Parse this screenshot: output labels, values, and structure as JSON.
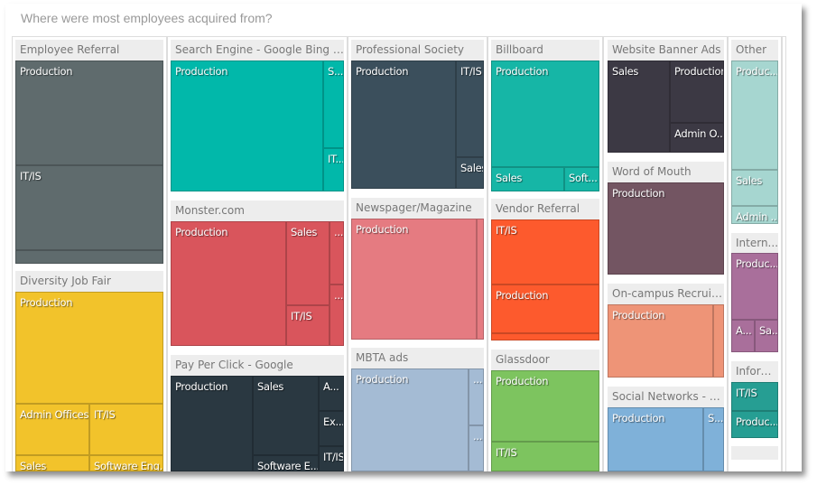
{
  "title": "Where were most employees acquired from?",
  "chart_data": {
    "type": "treemap",
    "title": "Where were most employees acquired from?",
    "groups": [
      {
        "name": "Employee Referral",
        "color": "#5f6b6d",
        "cells": [
          "Production",
          "IT/IS",
          ""
        ]
      },
      {
        "name": "Diversity Job Fair",
        "color": "#f2c32b",
        "cells": [
          "Production",
          "Admin Offices",
          "IT/IS",
          "Sales",
          "Software Eng..."
        ]
      },
      {
        "name": "Search Engine - Google Bing Yah...",
        "color": "#01b8aa",
        "cells": [
          "Production",
          "S...",
          "IT..."
        ]
      },
      {
        "name": "Monster.com",
        "color": "#d9555c",
        "cells": [
          "Production",
          "Sales",
          "IT/IS",
          "...",
          "..."
        ]
      },
      {
        "name": "Pay Per Click - Google",
        "color": "#2a3841",
        "cells": [
          "Production",
          "Sales",
          "Software E...",
          "A...",
          "Ex...",
          "IT/IS"
        ]
      },
      {
        "name": "Professional Society",
        "color": "#3b4f5c",
        "cells": [
          "Production",
          "IT/IS",
          "Sales"
        ]
      },
      {
        "name": "Newspager/Magazine",
        "color": "#e57b81",
        "cells": [
          "Production",
          ""
        ]
      },
      {
        "name": "MBTA ads",
        "color": "#a4bbd4",
        "cells": [
          "Production",
          "...",
          "..."
        ]
      },
      {
        "name": "Billboard",
        "color": "#16b6a6",
        "cells": [
          "Production",
          "Sales",
          "Soft..."
        ]
      },
      {
        "name": "Vendor Referral",
        "color": "#fd5a2d",
        "cells": [
          "IT/IS",
          "Production",
          ""
        ]
      },
      {
        "name": "Glassdoor",
        "color": "#7dc45f",
        "cells": [
          "Production",
          "IT/IS"
        ]
      },
      {
        "name": "Website Banner Ads",
        "color": "#3c3944",
        "cells": [
          "Sales",
          "Production",
          "Admin O..."
        ]
      },
      {
        "name": "Word of Mouth",
        "color": "#735562",
        "cells": [
          "Production"
        ]
      },
      {
        "name": "On-campus Recruiting",
        "color": "#ee9477",
        "cells": [
          "Production",
          ""
        ]
      },
      {
        "name": "Social Networks - Fa...",
        "color": "#7fb1d9",
        "cells": [
          "Production",
          "S..."
        ]
      },
      {
        "name": "Other",
        "color": "#a6d6d0",
        "cells": [
          "Produc...",
          "Sales",
          "Admin ..."
        ]
      },
      {
        "name": "Intern...",
        "color": "#a96f9b",
        "cells": [
          "Produc...",
          "A...",
          "Sa..."
        ]
      },
      {
        "name": "Inform...",
        "color": "#269e93",
        "cells": [
          "IT/IS",
          "Produc..."
        ]
      },
      {
        "name": "",
        "color": "#ededed",
        "cells": []
      }
    ]
  }
}
